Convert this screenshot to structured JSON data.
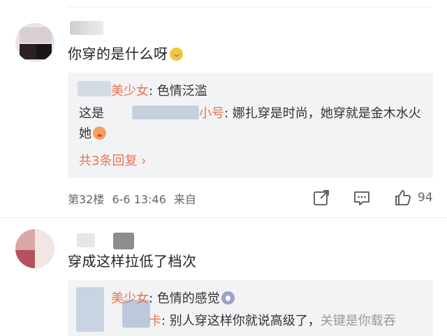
{
  "comment1": {
    "text": "你穿的是什么呀",
    "emoji": "sad-face-emoji",
    "replies": [
      {
        "name": "美少女",
        "text": ": 色情泛滥"
      },
      {
        "prefix": "这是",
        "name": "小号",
        "text": ": 娜扎穿是时尚，她穿就是金木水火她",
        "emoji": "wink-face-emoji"
      }
    ],
    "more_replies": "共3条回复",
    "floor": "第32楼",
    "datetime": "6-6 13:46",
    "source": "来自",
    "like_count": "94",
    "icons": {
      "share": "share-icon",
      "comment": "comment-icon",
      "like": "thumbs-up-icon"
    }
  },
  "comment2": {
    "text": "穿成这样拉低了档次",
    "replies": [
      {
        "name": "美少女",
        "text": ": 色情的感觉",
        "emoji": "shocked-face-emoji"
      },
      {
        "name": "卡",
        "text": ": 别人穿这样你就说高级了，",
        "tail": "关键是你载吞"
      }
    ]
  },
  "colors": {
    "username": "#eb7350",
    "reply_bg": "#f2f3f5",
    "text": "#222222",
    "meta": "#666666"
  }
}
